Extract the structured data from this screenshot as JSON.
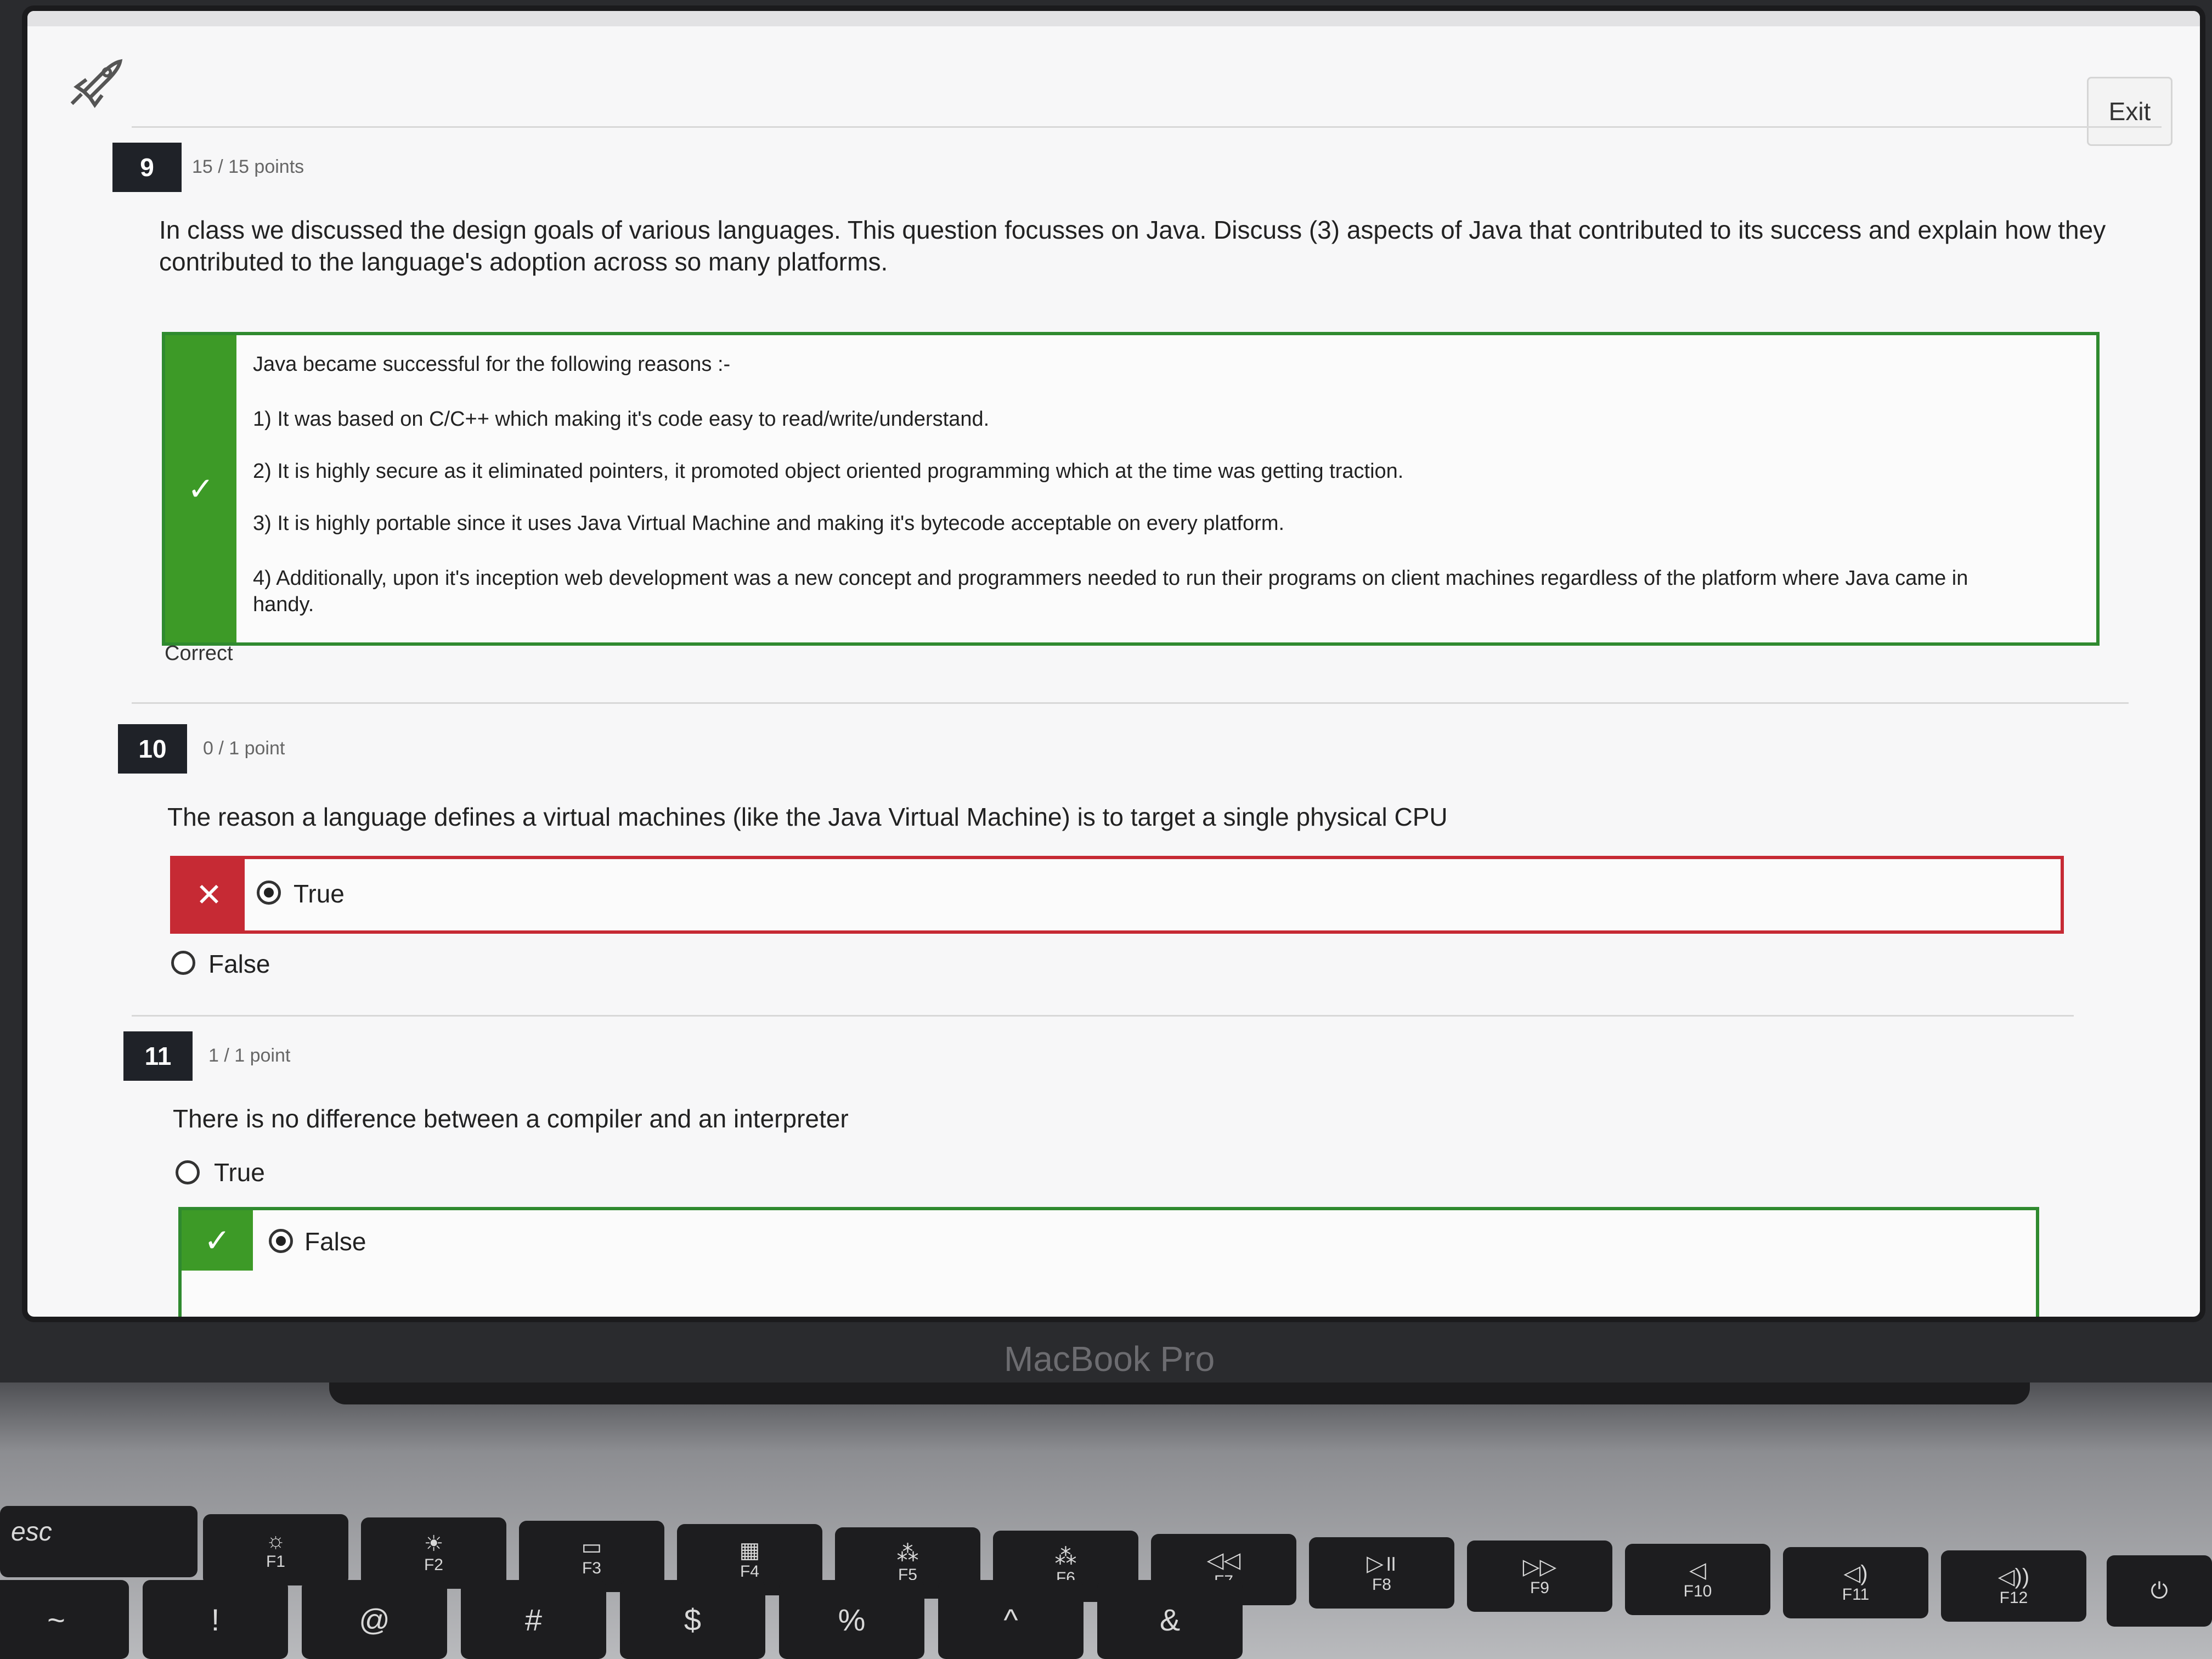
{
  "header": {
    "rocket_icon": "rocket-icon",
    "exit_label": "Exit"
  },
  "questions": [
    {
      "number": "9",
      "points": "15 / 15 points",
      "text_line1": "In class we discussed the design goals of various languages.  This question focusses on Java. Discuss (3) aspects of Java that contributed to its success and explain how they",
      "text_line2": "contributed to the language's adoption across so many platforms.",
      "answer_lines": [
        "Java became successful for the following reasons :-",
        "1) It was based on C/C++ which making it's code easy to read/write/understand.",
        "2) It is highly secure as it eliminated pointers, it promoted object oriented programming which at the time was getting traction.",
        "3) It is highly portable since it uses Java Virtual Machine and making it's bytecode acceptable on every platform.",
        "4) Additionally, upon it's inception web development was a new concept and programmers needed to run their programs on client machines regardless of the platform where Java came in",
        "handy."
      ],
      "status": "Correct",
      "marker": "check-icon"
    },
    {
      "number": "10",
      "points": "0 / 1 point",
      "text": "The reason a language defines a virtual machines (like the Java Virtual Machine) is to target a single physical CPU",
      "options": [
        "True",
        "False"
      ],
      "selected": "True",
      "marker": "x-icon"
    },
    {
      "number": "11",
      "points": "1 / 1 point",
      "text": "There is no difference between a compiler and an interpreter",
      "options": [
        "True",
        "False"
      ],
      "selected": "False",
      "marker": "check-icon"
    }
  ],
  "colors": {
    "correct_green": "#3d9a27",
    "wrong_red": "#c62a34",
    "question_badge": "#1f2228"
  },
  "device": {
    "label": "MacBook Pro"
  },
  "keyboard": {
    "esc": "esc",
    "function_keys": [
      "F1",
      "F2",
      "F3",
      "F4",
      "F5",
      "F6",
      "F7",
      "F8",
      "F9",
      "F10",
      "F11",
      "F12"
    ],
    "function_icons": [
      "brightness-down-icon",
      "brightness-up-icon",
      "mission-control-icon",
      "launchpad-icon",
      "keyboard-light-down-icon",
      "keyboard-light-up-icon",
      "rewind-icon",
      "play-pause-icon",
      "fast-forward-icon",
      "mute-icon",
      "volume-down-icon",
      "volume-up-icon"
    ],
    "power_icon": "power-icon",
    "number_row": [
      "~",
      "!",
      "@",
      "#",
      "$",
      "%",
      "^",
      "&"
    ]
  }
}
